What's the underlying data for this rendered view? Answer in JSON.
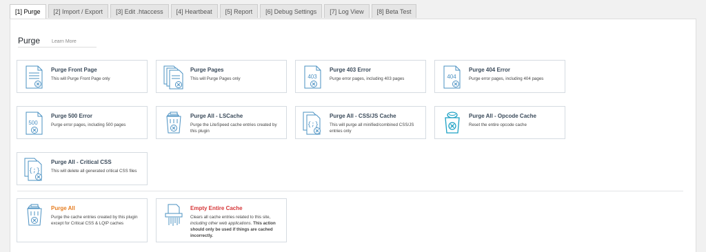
{
  "tabs": [
    {
      "label": "[1] Purge",
      "active": true
    },
    {
      "label": "[2] Import / Export"
    },
    {
      "label": "[3] Edit .htaccess"
    },
    {
      "label": "[4] Heartbeat"
    },
    {
      "label": "[5] Report"
    },
    {
      "label": "[6] Debug Settings"
    },
    {
      "label": "[7] Log View"
    },
    {
      "label": "[8] Beta Test"
    }
  ],
  "section": {
    "title": "Purge",
    "learn_more": "Learn More"
  },
  "cards": [
    {
      "title": "Purge Front Page",
      "desc": "This will Purge Front Page only",
      "icon": "purge-front-page-icon"
    },
    {
      "title": "Purge Pages",
      "desc": "This will Purge Pages only",
      "icon": "purge-pages-icon"
    },
    {
      "title": "Purge 403 Error",
      "desc": "Purge error pages, including 403 pages",
      "icon": "error-403-icon",
      "code": "403"
    },
    {
      "title": "Purge 404 Error",
      "desc": "Purge error pages, including 404 pages",
      "icon": "error-404-icon",
      "code": "404"
    },
    {
      "title": "Purge 500 Error",
      "desc": "Purge error pages, including 500 pages",
      "icon": "error-500-icon",
      "code": "500"
    },
    {
      "title": "Purge All - LSCache",
      "desc": "Purge the LiteSpeed cache entries created by this plugin",
      "icon": "trash-can-icon"
    },
    {
      "title": "Purge All - CSS/JS Cache",
      "desc": "This will purge all minified/combined CSS/JS entries only",
      "icon": "css-js-icon"
    },
    {
      "title": "Purge All - Opcode Cache",
      "desc": "Reset the entire opcode cache",
      "icon": "opcode-icon"
    },
    {
      "title": "Purge All - Critical CSS",
      "desc": "This will delete all generated critical CSS files",
      "icon": "critical-css-icon"
    }
  ],
  "purge_all": {
    "title": "Purge All",
    "desc": "Purge the cache entries created by this plugin except for Critical CSS & LQIP caches"
  },
  "empty_cache": {
    "title": "Empty Entire Cache",
    "desc_1": "Clears all cache entries related to this site,",
    "desc_2": "including other web applications.",
    "desc_3": "This action should only be used if things are cached incorrectly."
  },
  "colors": {
    "accent": "#4a90c2",
    "orange": "#e67e22",
    "red": "#d63638"
  }
}
